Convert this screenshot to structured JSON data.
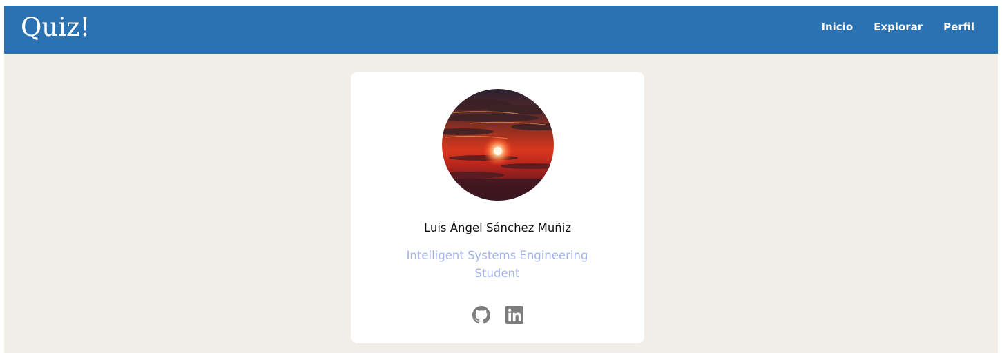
{
  "header": {
    "brand": "Quiz!",
    "nav": [
      "Inicio",
      "Explorar",
      "Perfil"
    ],
    "background_color": "#2a72b1"
  },
  "profile": {
    "avatar": "sunset-photo",
    "name": "Luis Ángel Sánchez Muñiz",
    "role": "Intelligent Systems Engineering Student",
    "role_color": "#a4b3ee",
    "social_links": [
      "github-icon",
      "linkedin-icon"
    ]
  },
  "page_background": "#f1eee7"
}
